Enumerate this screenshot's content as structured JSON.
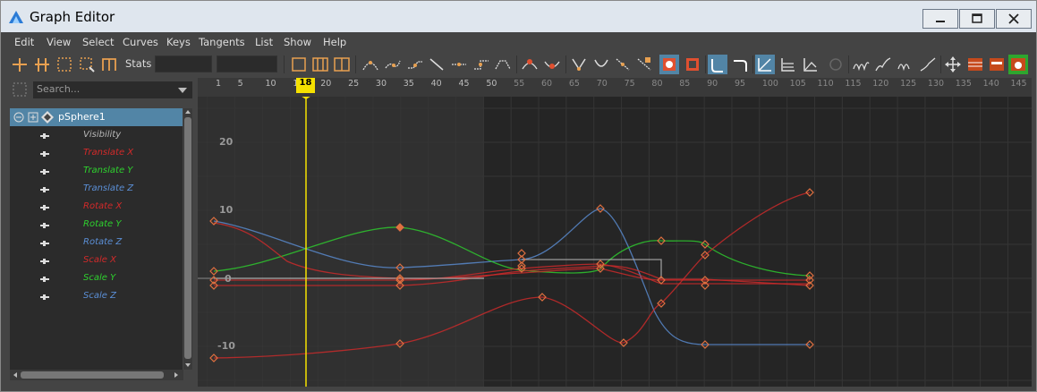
{
  "window": {
    "title": "Graph Editor"
  },
  "menu": [
    "Edit",
    "View",
    "Select",
    "Curves",
    "Keys",
    "Tangents",
    "List",
    "Show",
    "Help"
  ],
  "toolbar": {
    "stats_label": "Stats"
  },
  "outliner": {
    "search_placeholder": "Search...",
    "object": "pSphere1",
    "channels": [
      {
        "label": "Visibility",
        "color": "#b8b8b8"
      },
      {
        "label": "Translate X",
        "color": "#d22a2a"
      },
      {
        "label": "Translate Y",
        "color": "#2ed12e"
      },
      {
        "label": "Translate Z",
        "color": "#5b8fd6"
      },
      {
        "label": "Rotate X",
        "color": "#d22a2a"
      },
      {
        "label": "Rotate Y",
        "color": "#2ed12e"
      },
      {
        "label": "Rotate Z",
        "color": "#5b8fd6"
      },
      {
        "label": "Scale X",
        "color": "#d22a2a"
      },
      {
        "label": "Scale Y",
        "color": "#2ed12e"
      },
      {
        "label": "Scale Z",
        "color": "#5b8fd6"
      }
    ]
  },
  "timeline": {
    "ticks": [
      1,
      5,
      10,
      15,
      20,
      25,
      30,
      35,
      40,
      45,
      50,
      55,
      60,
      65,
      70,
      75,
      80,
      85,
      90,
      95,
      100,
      105,
      110,
      115,
      120,
      125,
      130,
      135,
      140,
      145
    ],
    "range_start": "1",
    "range_end": "50",
    "current_frame": "18"
  },
  "graph": {
    "y_labels": [
      "20",
      "10",
      "0",
      "-10"
    ],
    "accent_color": "#f5e100",
    "curves_color_scheme": {
      "x": "#d22a2a",
      "y": "#2ed12e",
      "z": "#5b8fd6"
    }
  }
}
